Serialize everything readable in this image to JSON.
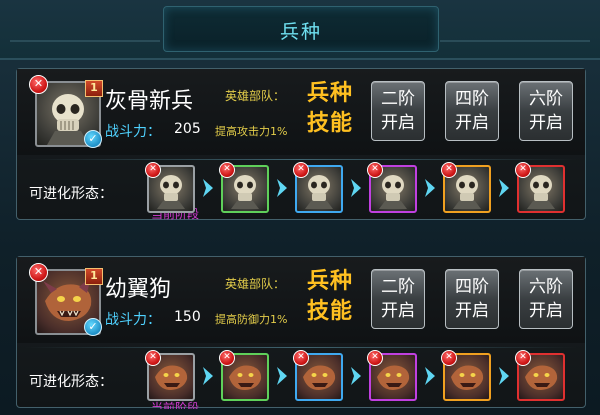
{
  "title": "兵种",
  "skill_title_line1": "兵种",
  "skill_title_line2": "技能",
  "stage_buttons": [
    {
      "line1": "二阶",
      "line2": "开启"
    },
    {
      "line1": "四阶",
      "line2": "开启"
    },
    {
      "line1": "六阶",
      "line2": "开启"
    }
  ],
  "units": [
    {
      "name": "灰骨新兵",
      "level": "1",
      "power_label": "战斗力：",
      "power_value": "205",
      "hero_label": "英雄部队：",
      "hero_bonus": "提高攻击力1%",
      "evo_label": "可进化形态：",
      "current_stage_label": "当前阶段",
      "evo_colors": [
        "#9aa0a4",
        "#5fd05a",
        "#3fa9f0",
        "#c040e0",
        "#f0a020",
        "#e03030"
      ]
    },
    {
      "name": "幼翼狗",
      "level": "1",
      "power_label": "战斗力：",
      "power_value": "150",
      "hero_label": "英雄部队：",
      "hero_bonus": "提高防御力1%",
      "evo_label": "可进化形态：",
      "current_stage_label": "当前阶段",
      "evo_colors": [
        "#9aa0a4",
        "#5fd05a",
        "#3fa9f0",
        "#c040e0",
        "#f0a020",
        "#e03030"
      ]
    }
  ],
  "icons": {
    "close": "close-icon",
    "check": "check-icon",
    "arrow": "chevron-right-icon"
  }
}
